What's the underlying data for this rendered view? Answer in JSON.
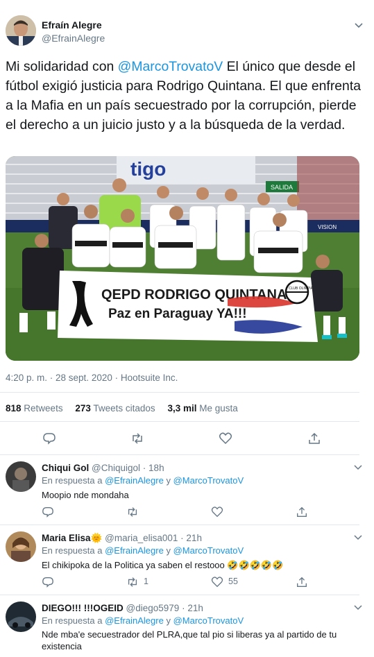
{
  "main_tweet": {
    "author_name": "Efraín Alegre",
    "author_handle": "@EfrainAlegre",
    "text_prefix": "Mi solidaridad con ",
    "mention": "@MarcoTrovatoV",
    "text_suffix": " El único que desde el fútbol exigió justicia para Rodrigo Quintana. El que enfrenta a la Mafia en un país secuestrado por la corrupción, pierde el derecho a un juicio justo y a la búsqueda de la verdad.",
    "photo": {
      "banner_line1": "QEPD RODRIGO QUINTANA",
      "banner_line2": "Paz en Paraguay YA!!!",
      "crest_text": "CLUB OLIMPIA",
      "stadium_text": "tigo",
      "salida_text": "SALIDA",
      "vision_text": "VISION"
    },
    "timestamp": "4:20 p. m. · 28 sept. 2020 · Hootsuite Inc.",
    "retweets_count": "818",
    "retweets_label": "Retweets",
    "quotes_count": "273",
    "quotes_label": "Tweets citados",
    "likes_count": "3,3 mil",
    "likes_label": "Me gusta"
  },
  "replies": [
    {
      "name": "Chiqui Gol",
      "handle": "@Chiquigol",
      "time": "18h",
      "reply_label": "En respuesta a",
      "mention1": "@EfrainAlegre",
      "joiner": "y",
      "mention2": "@MarcoTrovatoV",
      "text": "Moopio nde mondaha",
      "retweet_count": "",
      "like_count": ""
    },
    {
      "name": "Maria Elisa",
      "name_emoji": "🌞",
      "handle": "@maria_elisa001",
      "time": "21h",
      "reply_label": "En respuesta a",
      "mention1": "@EfrainAlegre",
      "joiner": "y",
      "mention2": "@MarcoTrovatoV",
      "text": "El chikipoka de la Politica ya saben el  restooo 🤣🤣🤣🤣🤣",
      "retweet_count": "1",
      "like_count": "55"
    },
    {
      "name": "DIEGO!!! !!!OGEID",
      "handle": "@diego5979",
      "time": "21h",
      "reply_label": "En respuesta a",
      "mention1": "@EfrainAlegre",
      "joiner": "y",
      "mention2": "@MarcoTrovatoV",
      "text": "Nde mba'e secuestrador del PLRA,que tal pio si liberas ya al partido de tu existencia",
      "retweet_count": "",
      "like_count": ""
    }
  ],
  "icons": [
    "chevron-down-icon",
    "reply-icon",
    "retweet-icon",
    "like-icon",
    "share-icon"
  ],
  "colors": {
    "link": "#1b95e0",
    "muted": "#657786",
    "text": "#14171a",
    "divider": "#e1e8ed"
  }
}
